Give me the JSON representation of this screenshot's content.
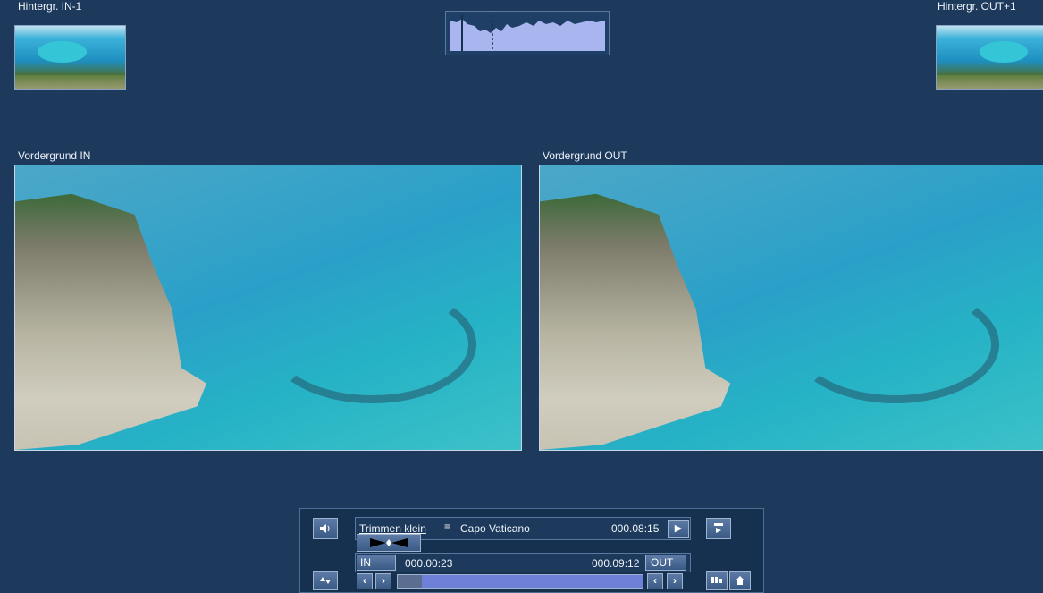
{
  "top": {
    "bg_in_label": "Hintergr. IN-1",
    "bg_out_label": "Hintergr. OUT+1"
  },
  "previews": {
    "fg_in_label": "Vordergrund IN",
    "fg_out_label": "Vordergrund OUT"
  },
  "panel": {
    "mode_label": "Trimmen klein",
    "menu_icon": "≡",
    "clip_name": "Capo Vaticano",
    "duration": "000.08:15",
    "play_icon": "▶",
    "in_label": "IN",
    "in_time": "000.00:23",
    "out_time": "000.09:12",
    "out_label": "OUT",
    "prev_icon": "‹",
    "next_icon": "›",
    "progress": 0.1
  },
  "icons": {
    "speaker": "speaker-icon",
    "trim": "trim-handle-icon",
    "updown": "up-down-icon",
    "export": "export-icon",
    "storyboard": "storyboard-icon",
    "home": "home-icon"
  },
  "colors": {
    "background": "#1d3a5c",
    "button": "#3a5a86",
    "progress_fill": "#6e7fd8",
    "waveform": "#a9b5ef"
  }
}
